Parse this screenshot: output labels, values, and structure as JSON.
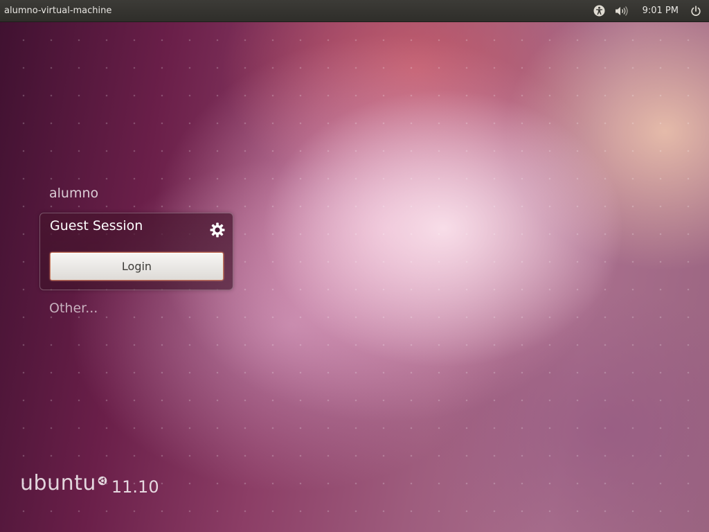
{
  "top_panel": {
    "hostname": "alumno-virtual-machine",
    "indicators": {
      "accessibility_icon": "accessibility-icon",
      "sound_icon": "volume-icon",
      "clock": "9:01 PM",
      "power_icon": "power-icon"
    }
  },
  "greeter": {
    "users": [
      {
        "name": "alumno"
      }
    ],
    "selected_session": {
      "title": "Guest Session",
      "settings_icon": "gear-icon",
      "login_label": "Login"
    },
    "other_label": "Other..."
  },
  "branding": {
    "wordmark": "ubuntu",
    "version": "11.10"
  },
  "colors": {
    "panel_background": "#3c3b37",
    "button_border": "#c8775b",
    "wallpaper_base": "#6a1f49"
  }
}
